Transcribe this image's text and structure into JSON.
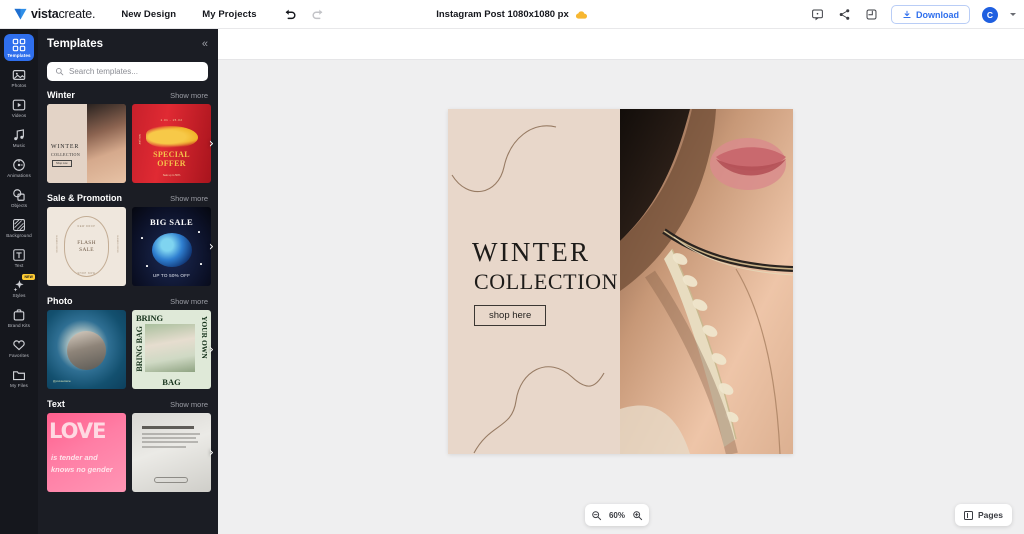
{
  "header": {
    "logo_text_bold": "vista",
    "logo_text_light": "create.",
    "nav": [
      {
        "label": "New Design",
        "name": "new-design"
      },
      {
        "label": "My Projects",
        "name": "my-projects"
      }
    ],
    "undo_icon": "undo-icon",
    "redo_icon": "redo-icon",
    "doc_title": "Instagram Post 1080x1080 px",
    "cloud_icon": "cloud-saved-icon",
    "comment_icon": "comment-icon",
    "share_icon": "share-icon",
    "resize_icon": "resize-icon",
    "download_label": "Download",
    "avatar_initial": "C",
    "accent_blue": "#2f6fed"
  },
  "rail": {
    "items": [
      {
        "label": "Templates",
        "icon": "templates-icon",
        "active": true
      },
      {
        "label": "Photos",
        "icon": "photos-icon",
        "active": false
      },
      {
        "label": "Videos",
        "icon": "videos-icon",
        "active": false
      },
      {
        "label": "Music",
        "icon": "music-icon",
        "active": false
      },
      {
        "label": "Animations",
        "icon": "animations-icon",
        "active": false
      },
      {
        "label": "Objects",
        "icon": "objects-icon",
        "active": false
      },
      {
        "label": "Background",
        "icon": "background-icon",
        "active": false
      },
      {
        "label": "Text",
        "icon": "text-icon",
        "active": false
      },
      {
        "label": "Styles",
        "icon": "styles-icon",
        "active": false,
        "badge": "NEW"
      },
      {
        "label": "Brand Kits",
        "icon": "brand-kits-icon",
        "active": false
      },
      {
        "label": "Favorites",
        "icon": "favorites-icon",
        "active": false
      },
      {
        "label": "My Files",
        "icon": "my-files-icon",
        "active": false
      }
    ]
  },
  "panel": {
    "title": "Templates",
    "collapse_icon": "collapse-chevron-icon",
    "search_placeholder": "Search templates...",
    "search_value": "",
    "show_more_label": "Show more",
    "sections": [
      {
        "title": "Winter",
        "cards": [
          {
            "name": "template-winter-collection",
            "title": "WINTER",
            "subtitle": "COLLECTION",
            "button": "Shop now"
          },
          {
            "name": "template-special-offer",
            "title": "SPECIAL",
            "subtitle": "OFFER",
            "top": "1.01 - 15.02",
            "bottom": "Sale up to 50%",
            "side": "new year"
          }
        ]
      },
      {
        "title": "Sale & Promotion",
        "cards": [
          {
            "name": "template-flash-sale",
            "title": "FLASH",
            "subtitle": "SALE",
            "top": "NEW DROP",
            "bottom": "SHOP NOW",
            "side": "SUMMER OFFER"
          },
          {
            "name": "template-big-sale",
            "title": "BIG SALE",
            "bottom": "UP TO 50% OFF"
          }
        ]
      },
      {
        "title": "Photo",
        "cards": [
          {
            "name": "template-photo-couple",
            "caption": "@yourusername"
          },
          {
            "name": "template-bring-bag",
            "title": "BRING",
            "side_left": "BRING BAG",
            "side_right": "YOUR OWN",
            "bottom": "BAG"
          }
        ]
      },
      {
        "title": "Text",
        "cards": [
          {
            "name": "template-love-quote",
            "title": "LOVE",
            "line2": "is tender and",
            "line3": "knows no gender"
          },
          {
            "name": "template-quote-card",
            "title": "Ask anything"
          }
        ]
      }
    ]
  },
  "canvas": {
    "design": {
      "title": "WINTER",
      "subtitle": "COLLECTION",
      "button_label": "shop here"
    },
    "zoom_out_icon": "zoom-out-icon",
    "zoom_level": "60%",
    "zoom_in_icon": "zoom-in-icon",
    "pages_label": "Pages",
    "pages_icon": "pages-icon"
  }
}
